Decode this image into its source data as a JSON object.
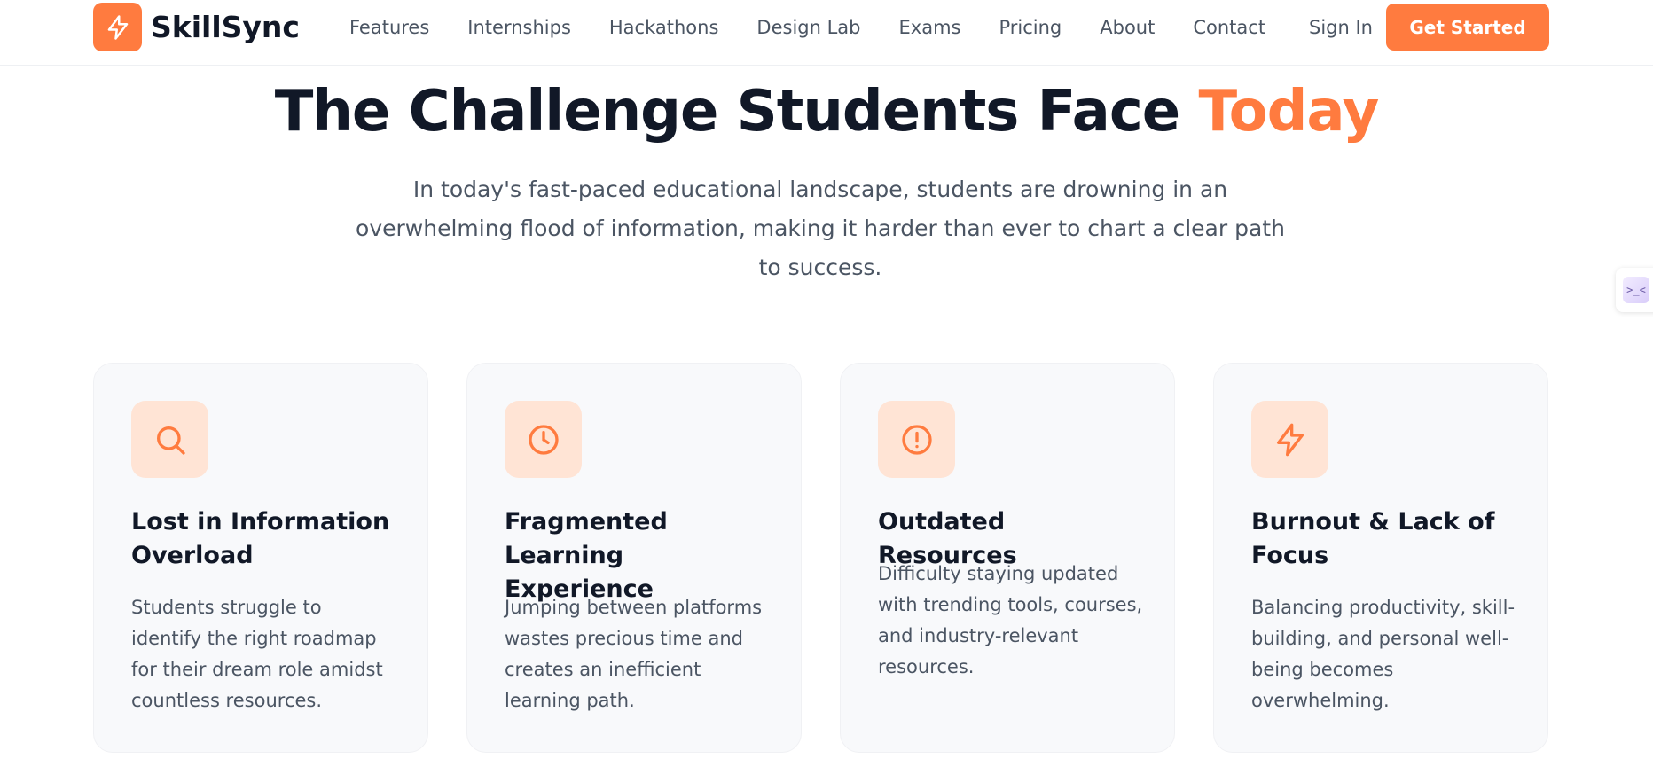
{
  "brand": {
    "name": "SkillSync",
    "logo_icon": "bolt-icon",
    "accent_color": "#ff7b3f"
  },
  "nav": {
    "links": [
      "Features",
      "Internships",
      "Hackathons",
      "Design Lab",
      "Exams",
      "Pricing",
      "About",
      "Contact"
    ],
    "sign_in": "Sign In",
    "cta": "Get Started"
  },
  "hero": {
    "heading_main": "The Challenge Students Face",
    "heading_accent": "Today",
    "intro": "In today's fast-paced educational landscape, students are drowning in an overwhelming flood of information, making it harder than ever to chart a clear path to success."
  },
  "side_widget": {
    "glyph": ">_<"
  },
  "cards": [
    {
      "icon": "search-icon",
      "title": "Lost in Information Overload",
      "description": "Students struggle to identify the right roadmap for their dream role amidst countless resources."
    },
    {
      "icon": "clock-icon",
      "title": "Fragmented Learning Experience",
      "description": "Jumping between platforms wastes precious time and creates an inefficient learning path."
    },
    {
      "icon": "alert-circle-icon",
      "title": "Outdated Resources",
      "description": "Difficulty staying updated with trending tools, courses, and industry-relevant resources."
    },
    {
      "icon": "bolt-icon",
      "title": "Burnout & Lack of Focus",
      "description": "Balancing productivity, skill-building, and personal well-being becomes overwhelming."
    }
  ]
}
